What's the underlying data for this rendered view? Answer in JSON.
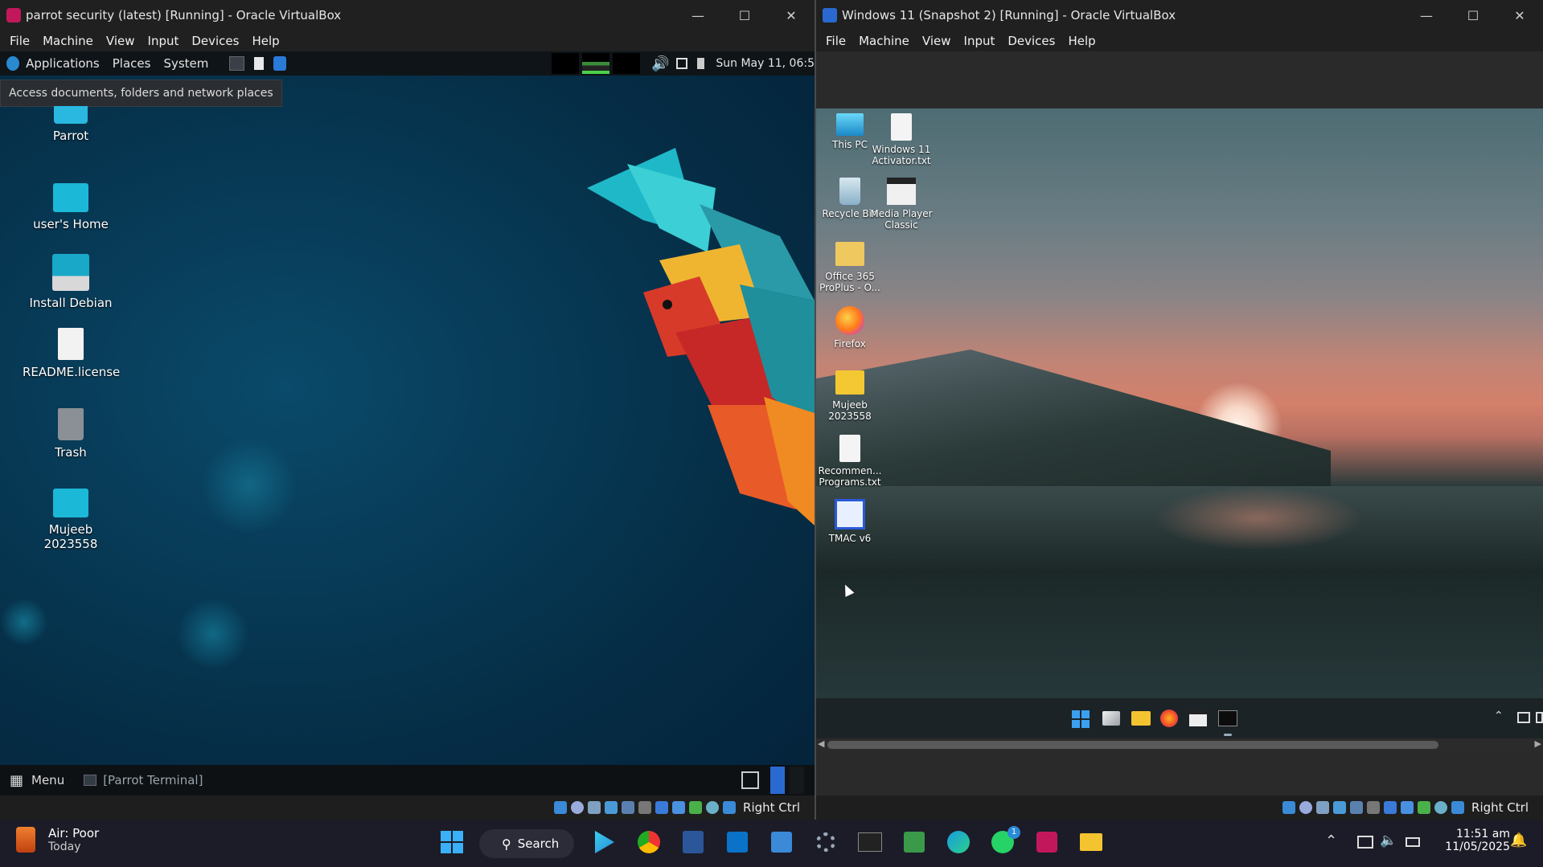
{
  "left_window": {
    "title": "parrot security (latest) [Running] - Oracle VirtualBox",
    "menu": [
      "File",
      "Machine",
      "View",
      "Input",
      "Devices",
      "Help"
    ],
    "host_key": "Right Ctrl",
    "guest": {
      "top_panel": {
        "applications": "Applications",
        "places": "Places",
        "system": "System",
        "clock": "Sun May 11, 06:5"
      },
      "tooltip": "Access documents, folders and network places",
      "desktop_icons": [
        "Parrot",
        "user's Home",
        "Install Debian",
        "README.license",
        "Trash",
        "Mujeeb 2023558"
      ],
      "bottom_panel": {
        "menu": "Menu",
        "task": "[Parrot Terminal]"
      }
    }
  },
  "right_window": {
    "title": "Windows 11 (Snapshot 2) [Running] - Oracle VirtualBox",
    "menu": [
      "File",
      "Machine",
      "View",
      "Input",
      "Devices",
      "Help"
    ],
    "host_key": "Right Ctrl",
    "guest": {
      "desktop_icons": [
        {
          "label": "This PC",
          "icon": "monitor-icon"
        },
        {
          "label": "Windows 11 Activator.txt",
          "icon": "text-file-icon"
        },
        {
          "label": "Recycle Bin",
          "icon": "recycle-bin-icon"
        },
        {
          "label": "Media Player Classic",
          "icon": "mpc-icon"
        },
        {
          "label": "Office 365 ProPlus - O...",
          "icon": "folder-icon"
        },
        {
          "label": "Firefox",
          "icon": "firefox-icon"
        },
        {
          "label": "Mujeeb 2023558",
          "icon": "folder-icon"
        },
        {
          "label": "Recommen... Programs.txt",
          "icon": "text-file-icon"
        },
        {
          "label": "TMAC v6",
          "icon": "tmac-icon"
        }
      ]
    }
  },
  "host_taskbar": {
    "weather_title": "Air: Poor",
    "weather_sub": "Today",
    "search_label": "Search",
    "time": "11:51 am",
    "date": "11/05/2025",
    "whatsapp_badge": "1"
  }
}
